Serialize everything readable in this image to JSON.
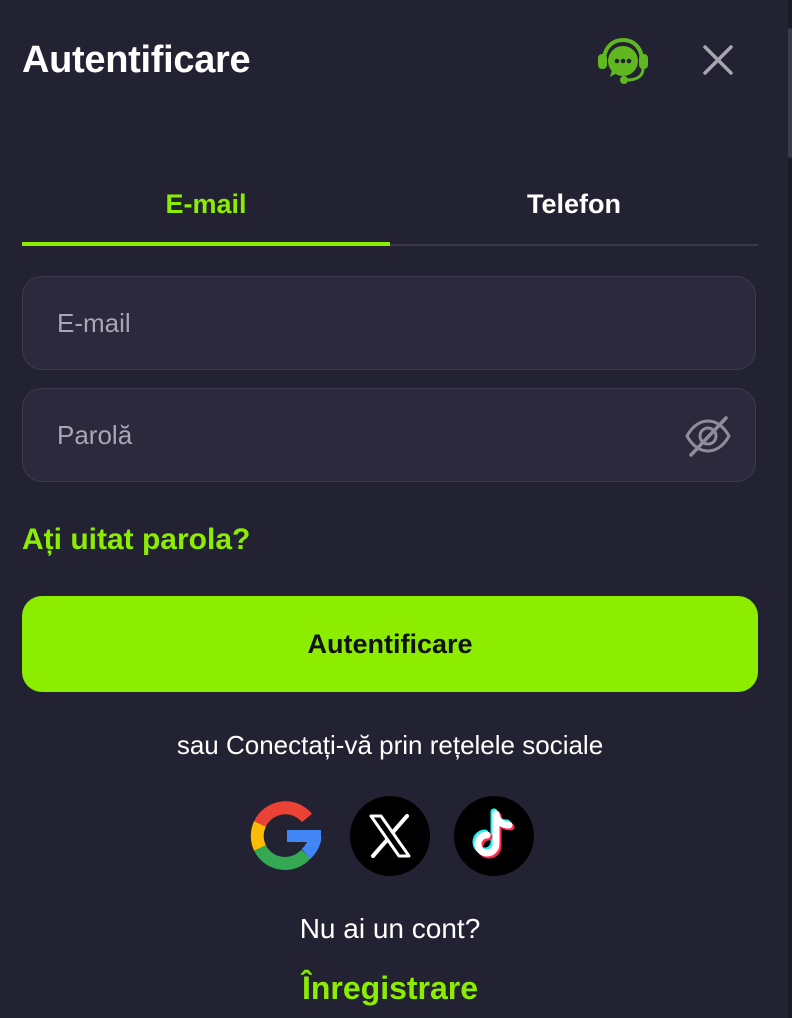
{
  "header": {
    "title": "Autentificare",
    "support_icon": "headset-chat-icon",
    "close_icon": "close-icon"
  },
  "tabs": [
    {
      "label": "E-mail",
      "active": true
    },
    {
      "label": "Telefon",
      "active": false
    }
  ],
  "form": {
    "email": {
      "placeholder": "E-mail",
      "value": ""
    },
    "password": {
      "placeholder": "Parolă",
      "value": "",
      "toggle_icon": "eye-off-icon"
    },
    "forgot_label": "Ați uitat parola?",
    "submit_label": "Autentificare"
  },
  "social": {
    "label": "sau Conectați-vă prin rețelele sociale",
    "providers": [
      {
        "name": "Google",
        "icon": "google-icon"
      },
      {
        "name": "X",
        "icon": "x-icon"
      },
      {
        "name": "TikTok",
        "icon": "tiktok-icon"
      }
    ]
  },
  "footer": {
    "no_account": "Nu ai un cont?",
    "register_label": "Înregistrare"
  },
  "colors": {
    "background": "#232232",
    "accent": "#8ded00",
    "field_bg": "#2b293b",
    "field_border": "#3d3b50",
    "muted_text": "#a8a6b6"
  }
}
